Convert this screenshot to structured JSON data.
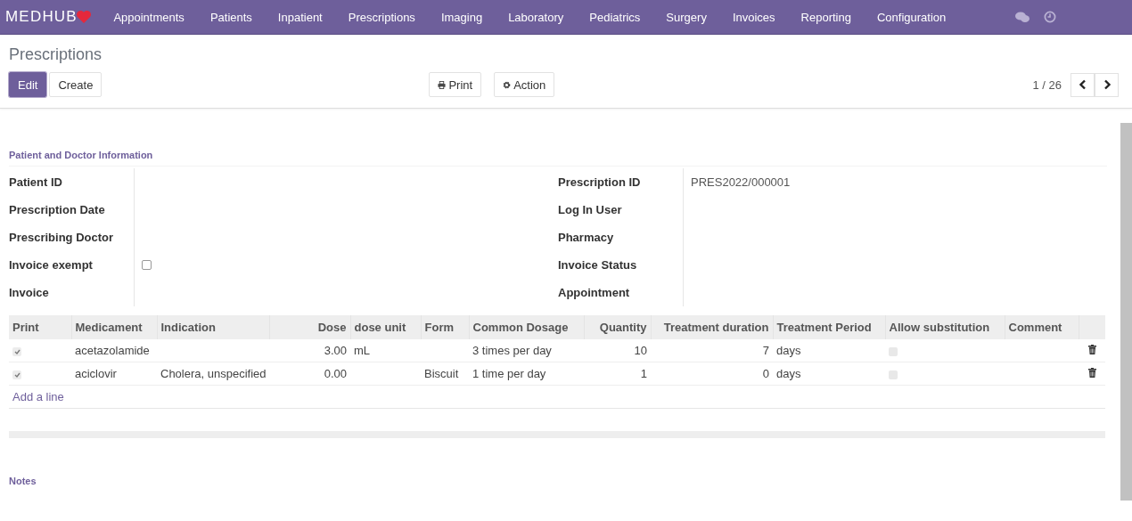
{
  "navbar": {
    "logo": "MEDHUB",
    "menu": [
      "Appointments",
      "Patients",
      "Inpatient",
      "Prescriptions",
      "Imaging",
      "Laboratory",
      "Pediatrics",
      "Surgery",
      "Invoices",
      "Reporting",
      "Configuration"
    ]
  },
  "breadcrumb": "Prescriptions",
  "buttons": [
    {
      "label": "Edit",
      "kind": "primary"
    },
    {
      "label": "Create",
      "kind": "default"
    }
  ],
  "actions": [
    {
      "label": "Print",
      "kind": "print"
    },
    {
      "label": "Action",
      "kind": "gear"
    }
  ],
  "pager": "1 / 26",
  "section_title": "Patient and Doctor Information",
  "left_fields": [
    {
      "label": "Patient ID"
    },
    {
      "label": "Prescription Date"
    },
    {
      "label": "Prescribing Doctor"
    },
    {
      "label": "Invoice exempt",
      "kind": "checkbox",
      "checked": false
    },
    {
      "label": "Invoice"
    }
  ],
  "right_fields": [
    {
      "label": "Prescription ID",
      "value": "PRES2022/000001"
    },
    {
      "label": "Log In User"
    },
    {
      "label": "Pharmacy"
    },
    {
      "label": "Invoice Status"
    },
    {
      "label": "Appointment"
    }
  ],
  "table": {
    "columns": [
      {
        "label": "Print",
        "kind": "check"
      },
      {
        "label": "Medicament",
        "kind": "text"
      },
      {
        "label": "Indication",
        "kind": "text"
      },
      {
        "label": "Dose",
        "kind": "number"
      },
      {
        "label": "dose unit",
        "kind": "text"
      },
      {
        "label": "Form",
        "kind": "text"
      },
      {
        "label": "Common Dosage",
        "kind": "text"
      },
      {
        "label": "Quantity",
        "kind": "number"
      },
      {
        "label": "Treatment duration",
        "kind": "number"
      },
      {
        "label": "Treatment Period",
        "kind": "text"
      },
      {
        "label": "Allow substitution",
        "kind": "check"
      },
      {
        "label": "Comment",
        "kind": "text"
      }
    ],
    "rows": [
      {
        "print": true,
        "medicament": "acetazolamide",
        "dose": "3.00",
        "dose_unit": "mL",
        "common_dosage": "3 times per day",
        "quantity": "10",
        "treatment_duration": "7",
        "treatment_period": "days",
        "allow_substitution": false
      },
      {
        "print": true,
        "medicament": "aciclovir",
        "indication": "Cholera, unspecified",
        "dose": "0.00",
        "form": "Biscuit",
        "common_dosage": "1 time per day",
        "quantity": "1",
        "treatment_duration": "0",
        "treatment_period": "days",
        "allow_substitution": false
      }
    ],
    "add_line": "Add a line"
  },
  "notes_title": "Notes"
}
